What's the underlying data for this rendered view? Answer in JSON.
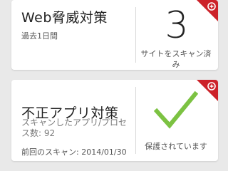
{
  "cards": [
    {
      "title": "Web脅威対策",
      "subtitle": "過去1日間",
      "count": "3",
      "count_label": "サイトをスキャン済み"
    },
    {
      "title": "不正アプリ対策",
      "apps_label_line1": "スキャンしたアプリ/プロセ",
      "apps_label_line2": "ス数: 92",
      "last_scan": "前回のスキャン: 2014/01/30",
      "status_label": "保護されています"
    }
  ],
  "colors": {
    "accent_red": "#cc2229",
    "check_green": "#7cc242"
  },
  "icons": [
    "shield-corner-icon",
    "checkmark-icon"
  ]
}
